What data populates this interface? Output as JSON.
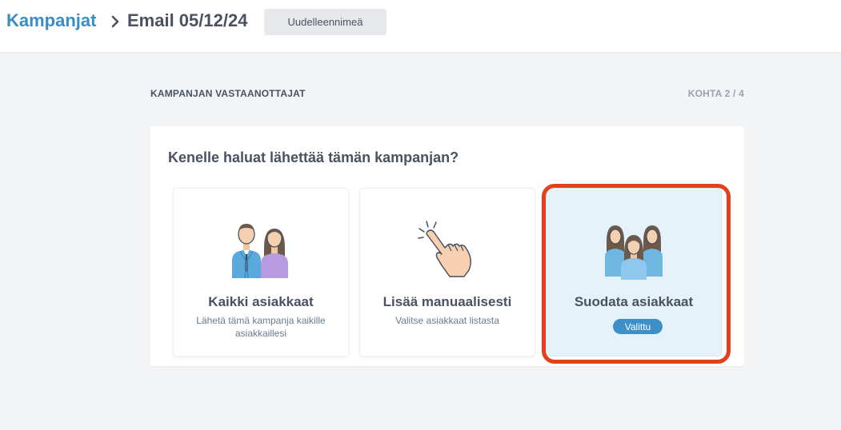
{
  "header": {
    "breadcrumb_parent": "Kampanjat",
    "title": "Email 05/12/24",
    "rename_button": "Uudelleennimeä"
  },
  "section": {
    "label": "KAMPANJAN VASTAANOTTAJAT",
    "step": "KOHTA 2 / 4"
  },
  "panel": {
    "question": "Kenelle haluat lähettää tämän kampanjan?",
    "options": [
      {
        "title": "Kaikki asiakkaat",
        "description": "Lähetä tämä kampanja kaikille asiakkaillesi",
        "icon": "couple-icon",
        "selected": false
      },
      {
        "title": "Lisää manuaalisesti",
        "description": "Valitse asiakkaat listasta",
        "icon": "pointing-hand-icon",
        "selected": false
      },
      {
        "title": "Suodata asiakkaat",
        "badge": "Valittu",
        "icon": "group-icon",
        "selected": true
      }
    ]
  },
  "colors": {
    "accent": "#3a8dc4",
    "highlight_border": "#e4401e",
    "selected_bg": "#e6f2f9",
    "badge_bg": "#3d8fc8"
  }
}
